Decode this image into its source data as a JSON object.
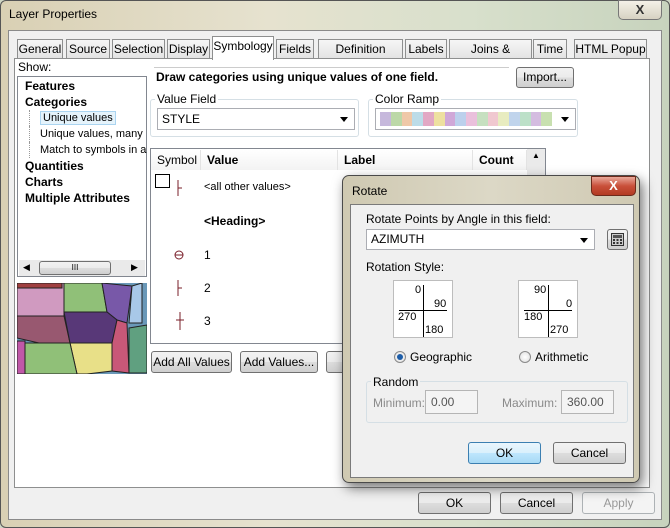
{
  "window": {
    "title": "Layer Properties",
    "close_label": "X"
  },
  "tabs": [
    {
      "label": "General"
    },
    {
      "label": "Source"
    },
    {
      "label": "Selection"
    },
    {
      "label": "Display"
    },
    {
      "label": "Symbology",
      "active": true
    },
    {
      "label": "Fields"
    },
    {
      "label": "Definition Query"
    },
    {
      "label": "Labels"
    },
    {
      "label": "Joins & Relates"
    },
    {
      "label": "Time"
    },
    {
      "label": "HTML Popup"
    }
  ],
  "show": {
    "label": "Show:",
    "items": [
      {
        "label": "Features",
        "bold": true
      },
      {
        "label": "Categories",
        "bold": true
      },
      {
        "label": "Unique values",
        "selected": true
      },
      {
        "label": "Unique values, many"
      },
      {
        "label": "Match to symbols in a"
      },
      {
        "label": "Quantities",
        "bold": true
      },
      {
        "label": "Charts",
        "bold": true
      },
      {
        "label": "Multiple Attributes",
        "bold": true
      }
    ],
    "scroll_glyph": "III"
  },
  "symbology": {
    "description": "Draw categories using unique values of one field.",
    "import_label": "Import...",
    "value_field_label": "Value Field",
    "value_field_value": "STYLE",
    "color_ramp_label": "Color Ramp",
    "color_ramp_colors": [
      "#c6b8dc",
      "#bcd8a8",
      "#efc8a8",
      "#bcdce8",
      "#e2a8c4",
      "#eee0a0",
      "#d0a8d8",
      "#bcd0ec",
      "#eac0dc",
      "#c6e0c0",
      "#f0c8d0",
      "#e8ecc0",
      "#c0d4ec",
      "#bce0c8",
      "#d4bce0",
      "#c8e0b0"
    ]
  },
  "table": {
    "columns": [
      "Symbol",
      "Value",
      "Label",
      "Count"
    ],
    "rows": [
      {
        "symbol": "tick-line",
        "value": "<all other values>",
        "bold": false
      },
      {
        "symbol": "",
        "value": "<Heading>",
        "bold": true
      },
      {
        "symbol": "circle-cross",
        "value": "1",
        "bold": false
      },
      {
        "symbol": "tick-line",
        "value": "2",
        "bold": false
      },
      {
        "symbol": "cross-line",
        "value": "3",
        "bold": false
      }
    ],
    "symbol_color": "#7a1f2a"
  },
  "buttons": {
    "add_all": "Add All Values",
    "add_values": "Add Values...",
    "ok": "OK",
    "cancel": "Cancel",
    "apply": "Apply"
  },
  "rotate": {
    "title": "Rotate",
    "close_label": "X",
    "field_label": "Rotate Points by Angle in this field:",
    "field_value": "AZIMUTH",
    "style_label": "Rotation Style:",
    "geographic": {
      "top": "0",
      "right": "90",
      "left": "270",
      "bottom": "180",
      "label": "Geographic",
      "selected": true
    },
    "arithmetic": {
      "top": "90",
      "right": "0",
      "left": "180",
      "bottom": "270",
      "label": "Arithmetic",
      "selected": false
    },
    "random_label": "Random",
    "minimum_label": "Minimum:",
    "minimum_value": "0.00",
    "maximum_label": "Maximum:",
    "maximum_value": "360.00",
    "ok": "OK",
    "cancel": "Cancel"
  }
}
